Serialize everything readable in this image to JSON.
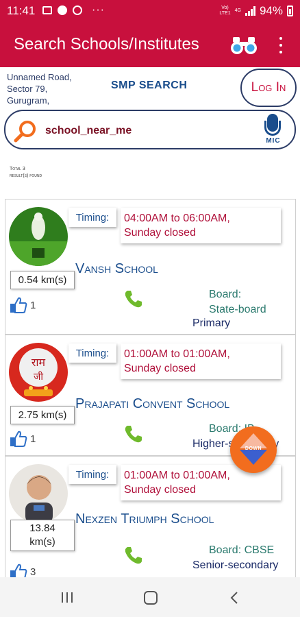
{
  "status_bar": {
    "time": "11:41",
    "battery": "94%",
    "network": "4G",
    "more": "···",
    "icons": [
      "image-icon",
      "spotify-icon",
      "hotspot-icon",
      "more-icon",
      "volte-icon",
      "signal-icon",
      "battery-icon"
    ]
  },
  "app_bar": {
    "title": "Search Schools/Institutes",
    "icons": [
      "binoculars-icon",
      "overflow-menu-icon"
    ]
  },
  "header": {
    "address": "Unnamed Road, Sector 79, Gurugram,",
    "smp_title": "SMP SEARCH",
    "login_label": "Log In"
  },
  "search": {
    "query": "school_near_me",
    "mic_label": "MIC"
  },
  "results": {
    "line1": "Total 3",
    "line2": "result(s) found",
    "count": 3
  },
  "timing_label": "Timing:",
  "schools": [
    {
      "name": "Vansh School",
      "timing": "04:00AM to 06:00AM,\nSunday closed",
      "distance": "0.54 km(s)",
      "likes": "1",
      "board": "Board:\nState-board",
      "level": "Primary",
      "avatar": "good-morning-lord-image"
    },
    {
      "name": "Prajapati Convent School",
      "timing": "01:00AM to 01:00AM,\nSunday closed",
      "distance": "2.75 km(s)",
      "likes": "1",
      "board": "Board: IB",
      "level": "Higher-secondary",
      "avatar": "ram-ram-ji-image"
    },
    {
      "name": "Nexzen Triumph School",
      "timing": "01:00AM to 01:00AM,\nSunday closed",
      "distance": "13.84\nkm(s)",
      "likes": "3",
      "board": "Board: CBSE",
      "level": "Senior-secondary",
      "avatar": "child-photo"
    }
  ],
  "fab": {
    "label": "DOWN"
  },
  "colors": {
    "primary": "#c8103d",
    "accent_blue": "#1a4d8c",
    "fab_orange": "#f26d1e",
    "phone_green": "#6fba2c"
  }
}
